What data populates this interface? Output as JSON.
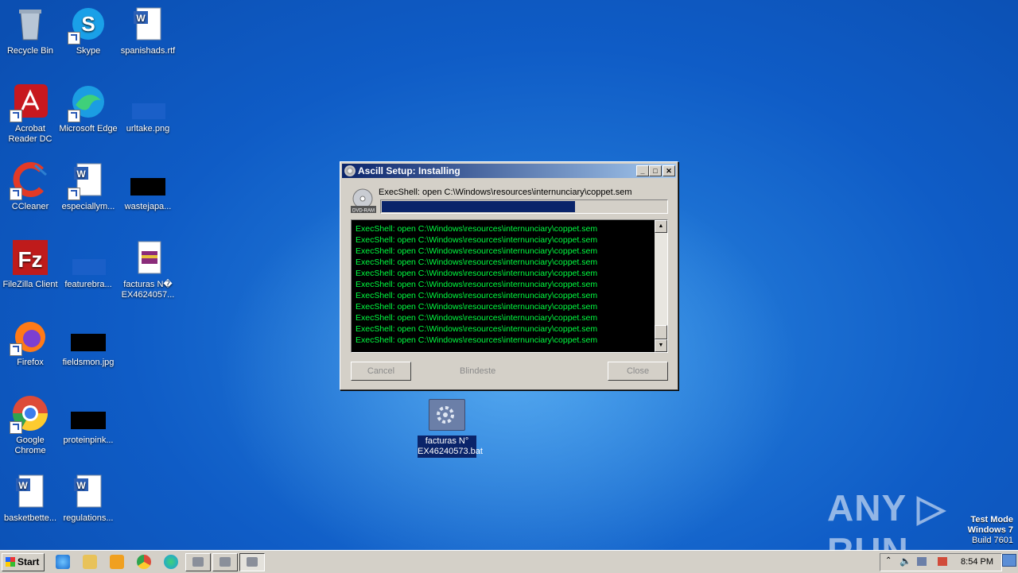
{
  "desktop": {
    "icons": [
      {
        "label": "Recycle Bin"
      },
      {
        "label": "Skype"
      },
      {
        "label": "spanishads.rtf"
      },
      {
        "label": "Acrobat Reader DC"
      },
      {
        "label": "Microsoft Edge"
      },
      {
        "label": "urltake.png"
      },
      {
        "label": "CCleaner"
      },
      {
        "label": "especiallym..."
      },
      {
        "label": "wastejapa..."
      },
      {
        "label": "FileZilla Client"
      },
      {
        "label": "featurebra..."
      },
      {
        "label": "facturas N� EX4624057..."
      },
      {
        "label": "Firefox"
      },
      {
        "label": "fieldsmon.jpg"
      },
      {
        "label": "Google Chrome"
      },
      {
        "label": "proteinpink..."
      },
      {
        "label": "basketbette..."
      },
      {
        "label": "regulations..."
      }
    ],
    "selected_file": {
      "label": "facturas N° EX46240573.bat"
    }
  },
  "setup_window": {
    "title": "Ascill Setup: Installing",
    "status": "ExecShell: open C:\\Windows\\resources\\internunciary\\coppet.sem",
    "disc_label": "DVD-RAM",
    "progress": 0.68,
    "log": [
      "ExecShell: open C:\\Windows\\resources\\internunciary\\coppet.sem",
      "ExecShell: open C:\\Windows\\resources\\internunciary\\coppet.sem",
      "ExecShell: open C:\\Windows\\resources\\internunciary\\coppet.sem",
      "ExecShell: open C:\\Windows\\resources\\internunciary\\coppet.sem",
      "ExecShell: open C:\\Windows\\resources\\internunciary\\coppet.sem",
      "ExecShell: open C:\\Windows\\resources\\internunciary\\coppet.sem",
      "ExecShell: open C:\\Windows\\resources\\internunciary\\coppet.sem",
      "ExecShell: open C:\\Windows\\resources\\internunciary\\coppet.sem",
      "ExecShell: open C:\\Windows\\resources\\internunciary\\coppet.sem",
      "ExecShell: open C:\\Windows\\resources\\internunciary\\coppet.sem",
      "ExecShell: open C:\\Windows\\resources\\internunciary\\coppet.sem"
    ],
    "cancel_label": "Cancel",
    "branding": "Blindeste",
    "close_label": "Close",
    "btn_minimize": "_",
    "btn_maximize": "□",
    "btn_close": "✕"
  },
  "taskbar": {
    "start_label": "Start",
    "clock": "8:54 PM"
  },
  "watermark": "ANY ▷ RUN",
  "test_mode": {
    "line1": "Test Mode",
    "line2": "Windows 7",
    "line3": "Build 7601"
  },
  "colors": {
    "title_bar": "#0a246a",
    "progress": "#0a246a",
    "log_text": "#00ff41",
    "log_bg": "#000000"
  }
}
